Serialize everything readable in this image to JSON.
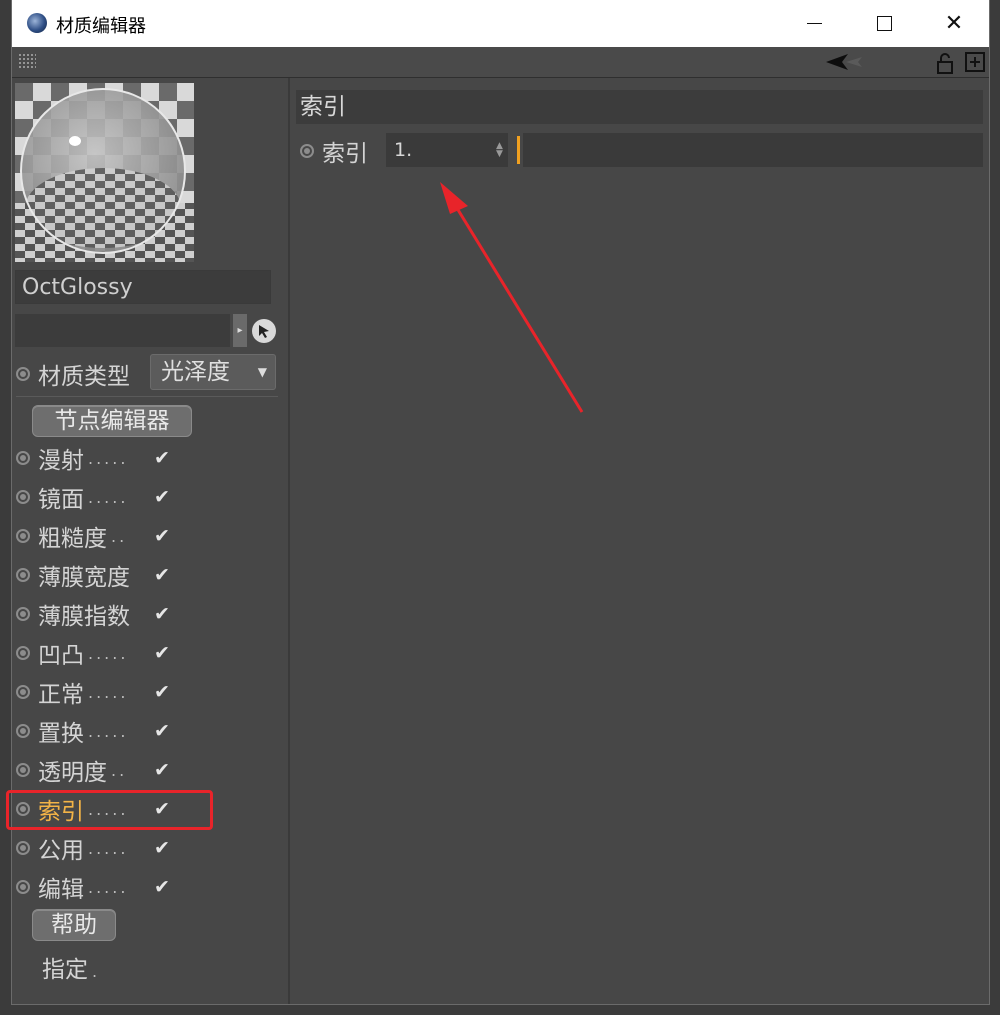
{
  "window": {
    "title": "材质编辑器",
    "minimize_icon": "minimize-icon",
    "maximize_icon": "maximize-icon",
    "close_icon": "close-icon"
  },
  "material": {
    "name": "OctGlossy",
    "type_label": "材质类型",
    "type_value": "光泽度",
    "node_editor_label": "节点编辑器"
  },
  "channels": [
    {
      "label": "漫射",
      "dots": ".....",
      "checked": true
    },
    {
      "label": "镜面",
      "dots": ".....",
      "checked": true
    },
    {
      "label": "粗糙度",
      "dots": "..",
      "checked": true
    },
    {
      "label": "薄膜宽度",
      "dots": "",
      "checked": true
    },
    {
      "label": "薄膜指数",
      "dots": "",
      "checked": true
    },
    {
      "label": "凹凸",
      "dots": ".....",
      "checked": true
    },
    {
      "label": "正常",
      "dots": ".....",
      "checked": true
    },
    {
      "label": "置换",
      "dots": ".....",
      "checked": true
    },
    {
      "label": "透明度",
      "dots": "..",
      "checked": true
    },
    {
      "label": "索引",
      "dots": ".....",
      "checked": true,
      "active": true
    },
    {
      "label": "公用",
      "dots": ".....",
      "checked": true
    },
    {
      "label": "编辑",
      "dots": ".....",
      "checked": true
    }
  ],
  "help_label": "帮助",
  "assign_label": "指定",
  "assign_dots": ".",
  "panel": {
    "section_title": "索引",
    "index_label": "索引",
    "index_value": "1."
  },
  "colors": {
    "active_channel": "#f2b347",
    "highlight_box": "#e8242a",
    "slider_handle": "#f0a020",
    "annotation_arrow": "#e8242a"
  }
}
